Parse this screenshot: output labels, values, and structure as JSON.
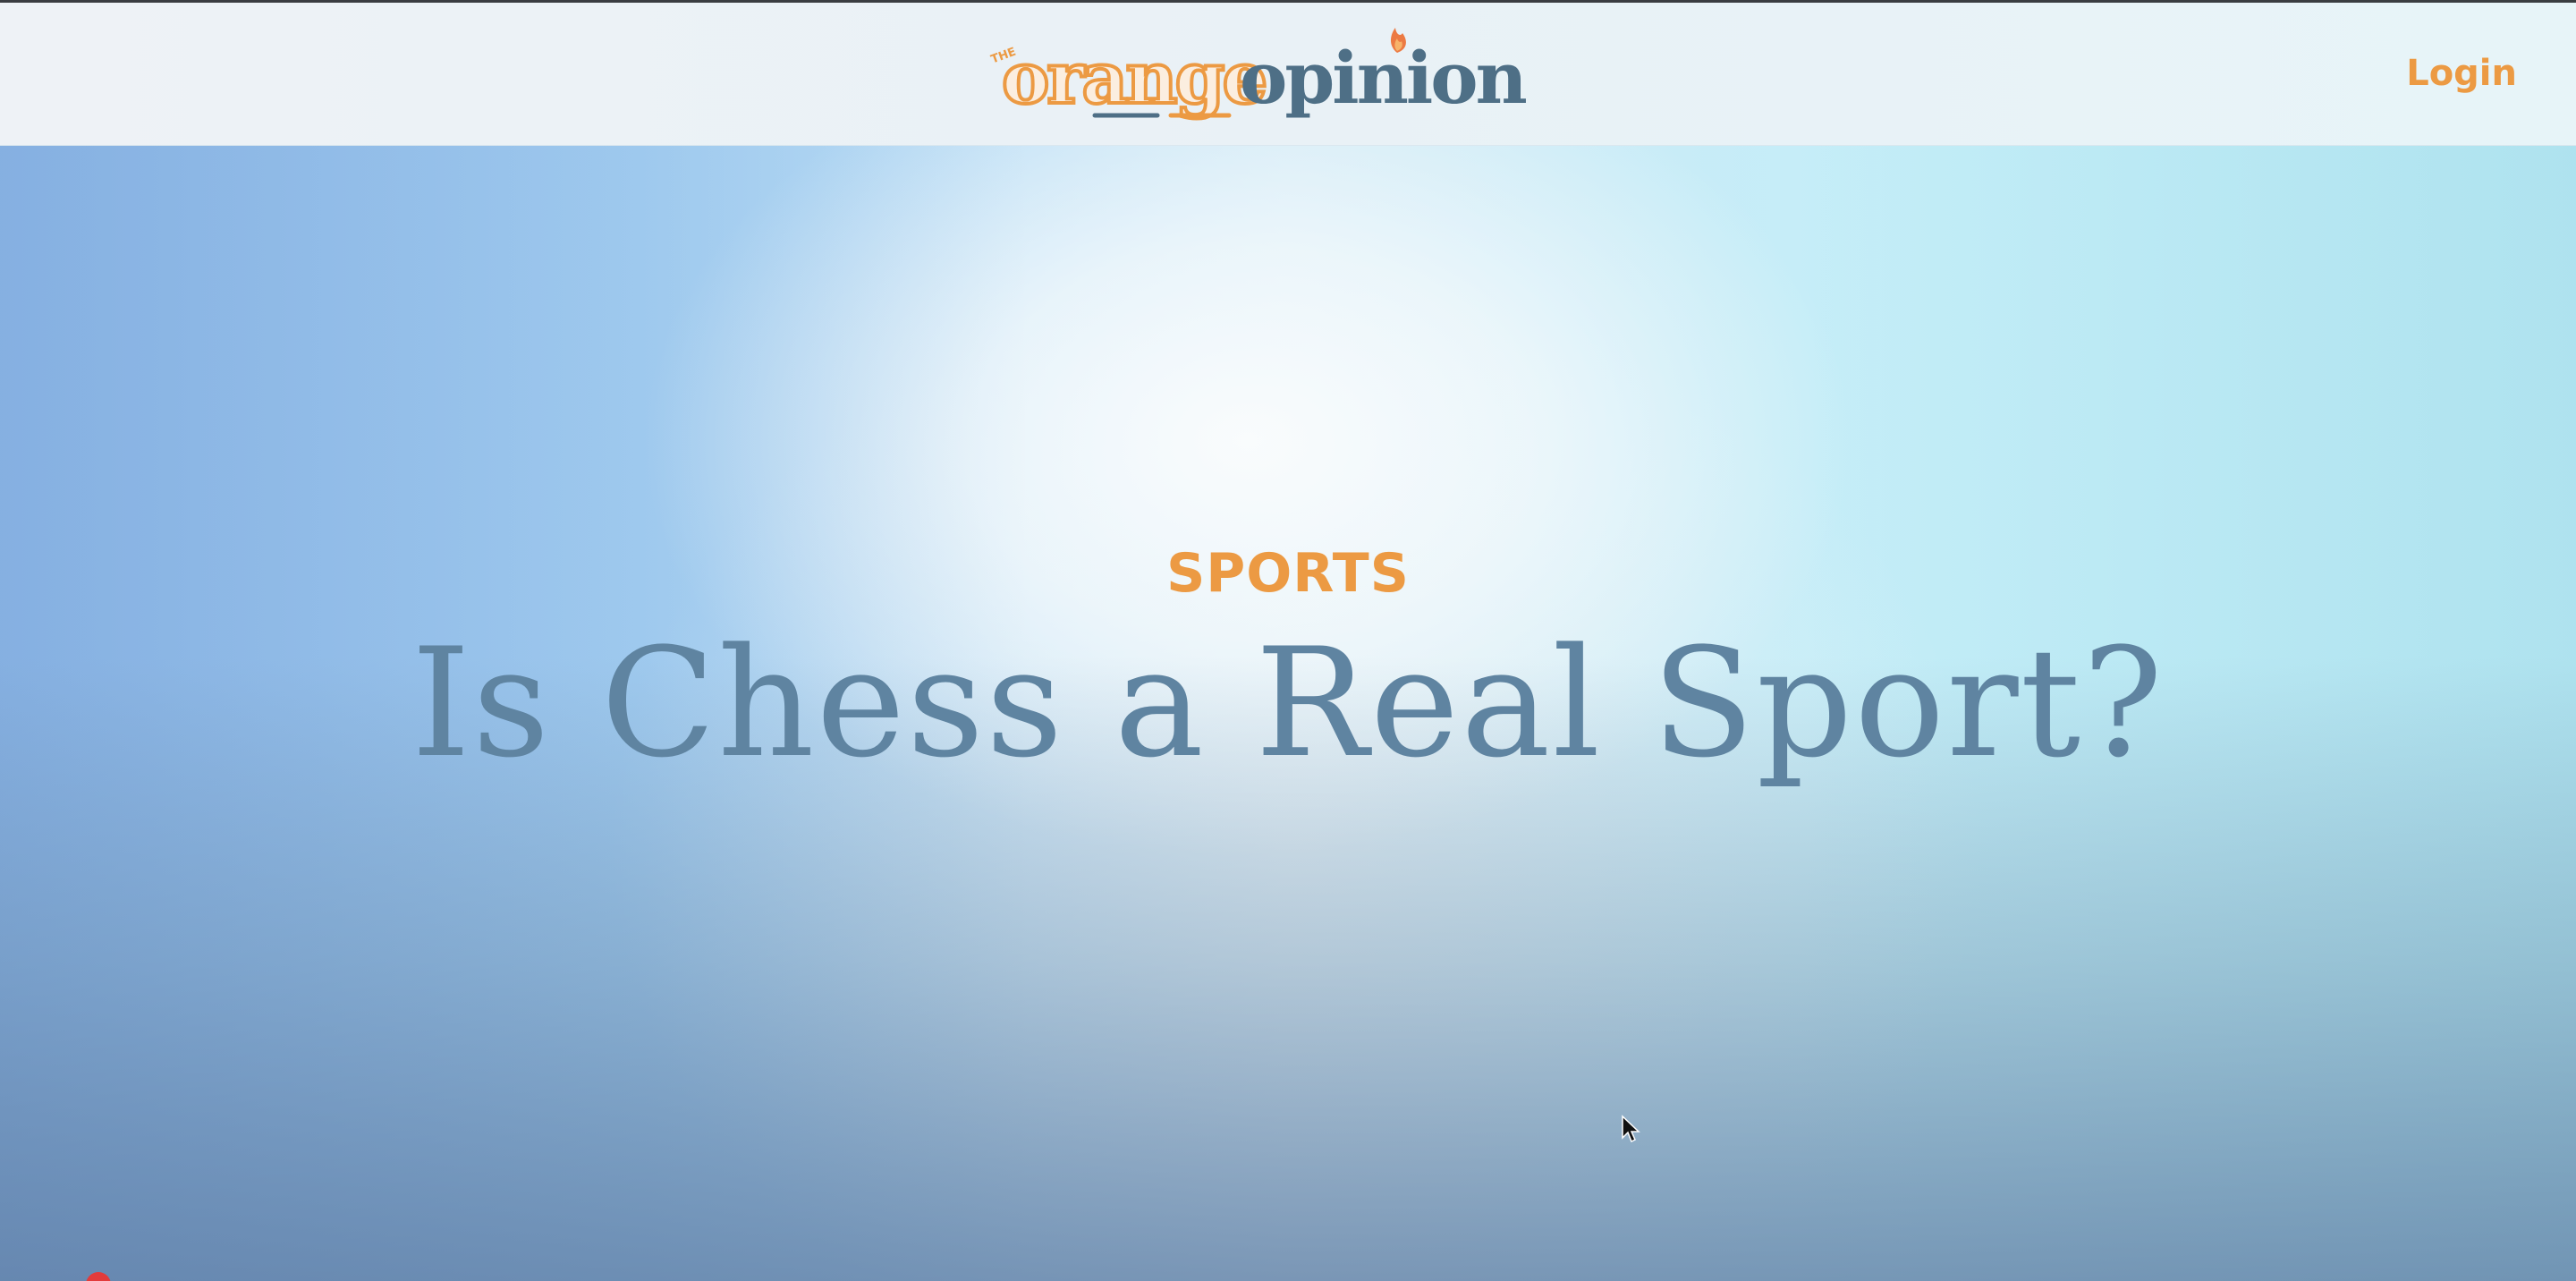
{
  "header": {
    "logo": {
      "prefix": "THE",
      "word1": "orange",
      "word2": "opinion",
      "alt": "The Orange Opinion"
    },
    "login_label": "Login"
  },
  "hero": {
    "category": "SPORTS",
    "title": "Is Chess a Real Sport?"
  },
  "colors": {
    "accent_orange": "#ec9a43",
    "title_blue": "#5f84a1",
    "logo_blue": "#4e6f86"
  },
  "icons": {
    "logo_flame": "flame-icon",
    "cursor": "mouse-pointer-icon"
  }
}
